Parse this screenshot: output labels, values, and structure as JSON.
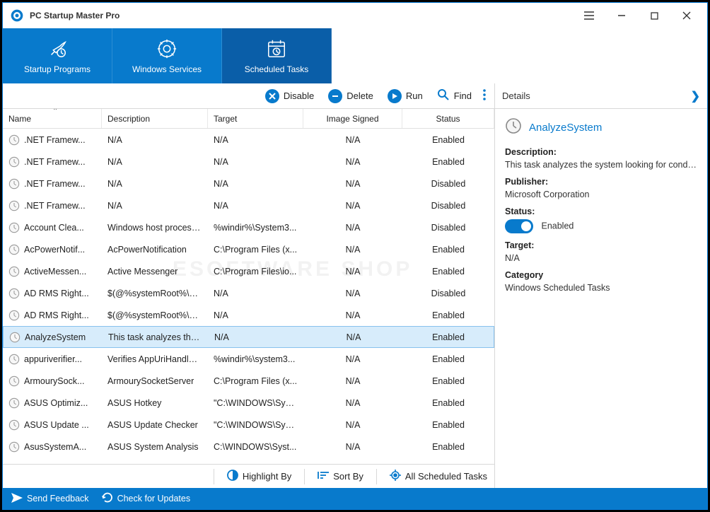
{
  "app": {
    "title": "PC Startup Master Pro"
  },
  "tabs": [
    {
      "label": "Startup Programs"
    },
    {
      "label": "Windows Services"
    },
    {
      "label": "Scheduled Tasks"
    }
  ],
  "toolbar": {
    "disable": "Disable",
    "delete": "Delete",
    "run": "Run",
    "find": "Find"
  },
  "columns": {
    "name": "Name",
    "description": "Description",
    "target": "Target",
    "signed": "Image Signed",
    "status": "Status"
  },
  "rows": [
    {
      "name": ".NET Framew...",
      "desc": "N/A",
      "target": "N/A",
      "signed": "N/A",
      "status": "Enabled"
    },
    {
      "name": ".NET Framew...",
      "desc": "N/A",
      "target": "N/A",
      "signed": "N/A",
      "status": "Enabled"
    },
    {
      "name": ".NET Framew...",
      "desc": "N/A",
      "target": "N/A",
      "signed": "N/A",
      "status": "Disabled"
    },
    {
      "name": ".NET Framew...",
      "desc": "N/A",
      "target": "N/A",
      "signed": "N/A",
      "status": "Disabled"
    },
    {
      "name": "Account Clea...",
      "desc": "Windows host process (...",
      "target": "%windir%\\System3...",
      "signed": "N/A",
      "status": "Disabled"
    },
    {
      "name": "AcPowerNotif...",
      "desc": "AcPowerNotification",
      "target": "C:\\Program Files (x...",
      "signed": "N/A",
      "status": "Enabled"
    },
    {
      "name": "ActiveMessen...",
      "desc": "Active Messenger",
      "target": "C:\\Program Files\\io...",
      "signed": "N/A",
      "status": "Enabled"
    },
    {
      "name": "AD RMS Right...",
      "desc": "$(@%systemRoot%\\Sys...",
      "target": "N/A",
      "signed": "N/A",
      "status": "Disabled"
    },
    {
      "name": "AD RMS Right...",
      "desc": "$(@%systemRoot%\\Sys...",
      "target": "N/A",
      "signed": "N/A",
      "status": "Enabled"
    },
    {
      "name": "AnalyzeSystem",
      "desc": "This task analyzes the sy...",
      "target": "N/A",
      "signed": "N/A",
      "status": "Enabled",
      "selected": true
    },
    {
      "name": "appuriverifier...",
      "desc": "Verifies AppUriHandler ...",
      "target": "%windir%\\system3...",
      "signed": "N/A",
      "status": "Enabled"
    },
    {
      "name": "ArmourySock...",
      "desc": "ArmourySocketServer",
      "target": "C:\\Program Files (x...",
      "signed": "N/A",
      "status": "Enabled"
    },
    {
      "name": "ASUS Optimiz...",
      "desc": "ASUS Hotkey",
      "target": "\"C:\\WINDOWS\\Syst...",
      "signed": "N/A",
      "status": "Enabled"
    },
    {
      "name": "ASUS Update ...",
      "desc": "ASUS Update Checker",
      "target": "\"C:\\WINDOWS\\Syst...",
      "signed": "N/A",
      "status": "Enabled"
    },
    {
      "name": "AsusSystemA...",
      "desc": "ASUS System Analysis",
      "target": "C:\\WINDOWS\\Syst...",
      "signed": "N/A",
      "status": "Enabled"
    }
  ],
  "bottombar": {
    "highlight": "Highlight By",
    "sort": "Sort By",
    "filter": "All Scheduled Tasks"
  },
  "details": {
    "header": "Details",
    "title": "AnalyzeSystem",
    "desc_label": "Description:",
    "desc_val": "This task analyzes the system looking for conditio...",
    "pub_label": "Publisher:",
    "pub_val": "Microsoft Corporation",
    "status_label": "Status:",
    "status_val": "Enabled",
    "target_label": "Target:",
    "target_val": "N/A",
    "cat_label": "Category",
    "cat_val": "Windows Scheduled Tasks"
  },
  "statusbar": {
    "feedback": "Send Feedback",
    "updates": "Check for Updates"
  },
  "watermark": "ESOFTWARE SHOP"
}
